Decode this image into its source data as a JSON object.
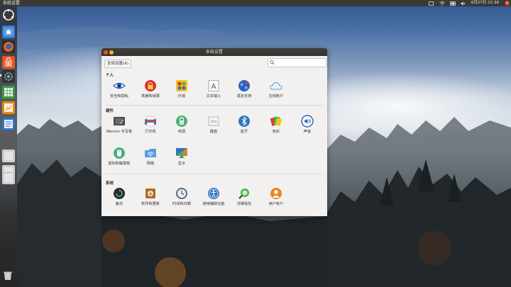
{
  "top_panel": {
    "window_title": "系统设置",
    "clock": "6月27日 22:38"
  },
  "launcher": {
    "items": [
      {
        "name": "dash-home",
        "icon": "ubuntu-logo-icon"
      },
      {
        "name": "files",
        "icon": "home-folder-icon"
      },
      {
        "name": "firefox",
        "icon": "firefox-icon"
      },
      {
        "name": "software-center",
        "icon": "shopping-bag-icon"
      },
      {
        "name": "system-settings",
        "icon": "settings-icon"
      },
      {
        "name": "calc",
        "icon": "spreadsheet-icon"
      },
      {
        "name": "impress",
        "icon": "presentation-icon"
      },
      {
        "name": "writer",
        "icon": "document-icon"
      },
      {
        "name": "drive-1",
        "icon": "drive-icon"
      },
      {
        "name": "drive-2",
        "icon": "drive-icon"
      },
      {
        "name": "drive-3",
        "icon": "drive-icon"
      },
      {
        "name": "trash",
        "icon": "trash-icon"
      }
    ]
  },
  "window": {
    "title": "系统设置",
    "all_settings_label": "全部设置(A)",
    "search": {
      "value": "",
      "placeholder": ""
    },
    "sections": {
      "personal": {
        "title": "个人",
        "items": [
          {
            "label": "安全和隐私",
            "icon": "eye-icon"
          },
          {
            "label": "亮度和锁屏",
            "icon": "lock-icon"
          },
          {
            "label": "外观",
            "icon": "appearance-icon"
          },
          {
            "label": "文本输入",
            "icon": "text-entry-icon"
          },
          {
            "label": "语言支持",
            "icon": "language-globe-icon"
          },
          {
            "label": "在线帐户",
            "icon": "cloud-icon"
          }
        ]
      },
      "hardware": {
        "title": "硬件",
        "items": [
          {
            "label": "Wacom 手写板",
            "icon": "tablet-icon"
          },
          {
            "label": "打印机",
            "icon": "printer-icon"
          },
          {
            "label": "电源",
            "icon": "battery-icon"
          },
          {
            "label": "键盘",
            "icon": "keyboard-icon"
          },
          {
            "label": "蓝牙",
            "icon": "bluetooth-icon"
          },
          {
            "label": "色彩",
            "icon": "color-icon"
          },
          {
            "label": "声音",
            "icon": "speaker-icon"
          },
          {
            "label": "鼠标和触摸板",
            "icon": "mouse-icon"
          },
          {
            "label": "网络",
            "icon": "network-folder-icon"
          },
          {
            "label": "显示",
            "icon": "display-icon"
          }
        ]
      },
      "system": {
        "title": "系统",
        "items": [
          {
            "label": "备份",
            "icon": "backup-icon"
          },
          {
            "label": "软件和更新",
            "icon": "software-updates-icon"
          },
          {
            "label": "时间和日期",
            "icon": "clock-icon"
          },
          {
            "label": "通用辅助功能",
            "icon": "accessibility-icon"
          },
          {
            "label": "详细信息",
            "icon": "details-search-icon"
          },
          {
            "label": "用户帐户",
            "icon": "user-accounts-icon"
          }
        ]
      }
    }
  },
  "colors": {
    "panel_bg": "#3b3a36",
    "close_button": "#e95420",
    "minimize_button": "#f7b32b",
    "window_bg": "#f2f1f0"
  }
}
